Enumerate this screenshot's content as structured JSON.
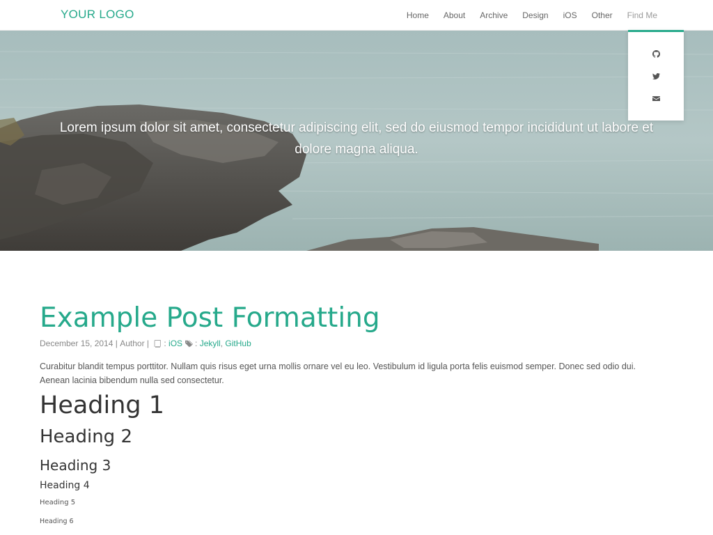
{
  "header": {
    "logo": "YOUR LOGO",
    "nav": [
      "Home",
      "About",
      "Archive",
      "Design",
      "iOS",
      "Other",
      "Find Me"
    ]
  },
  "dropdown": {
    "icons": [
      "github-icon",
      "twitter-icon",
      "envelope-icon"
    ]
  },
  "hero": {
    "text": "Lorem ipsum dolor sit amet, consectetur adipiscing elit, sed do eiusmod tempor incididunt ut labore et dolore magna aliqua."
  },
  "post": {
    "title": "Example Post Formatting",
    "date": "December 15, 2014",
    "sep1": " | ",
    "author": "Author",
    "sep2": " | ",
    "category_suffix": ": ",
    "category": "iOS",
    "tags_suffix": ": ",
    "tags": [
      "Jekyll",
      "GitHub"
    ],
    "tag_sep": ", ",
    "paragraph": "Curabitur blandit tempus porttitor. Nullam quis risus eget urna mollis ornare vel eu leo. Vestibulum id ligula porta felis euismod semper. Donec sed odio dui. Aenean lacinia bibendum nulla sed consectetur.",
    "headings": [
      "Heading 1",
      "Heading 2",
      "Heading 3",
      "Heading 4",
      "Heading 5",
      "Heading 6"
    ]
  },
  "colors": {
    "accent": "#26a98b",
    "text": "#555555",
    "heading": "#333333"
  }
}
